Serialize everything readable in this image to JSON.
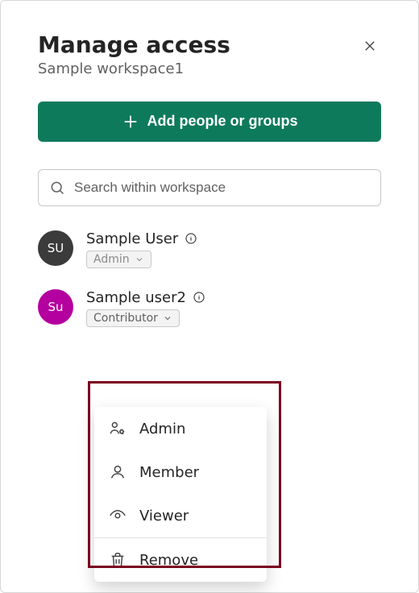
{
  "header": {
    "title": "Manage access",
    "subtitle": "Sample workspace1"
  },
  "add_button": {
    "label": "Add people or groups"
  },
  "search": {
    "placeholder": "Search within workspace"
  },
  "users": [
    {
      "initials": "SU",
      "name": "Sample User",
      "role": "Admin"
    },
    {
      "initials": "Su",
      "name": "Sample user2",
      "role": "Contributor"
    }
  ],
  "role_menu": {
    "items": [
      {
        "label": "Admin"
      },
      {
        "label": "Member"
      },
      {
        "label": "Viewer"
      },
      {
        "label": "Remove"
      }
    ]
  }
}
